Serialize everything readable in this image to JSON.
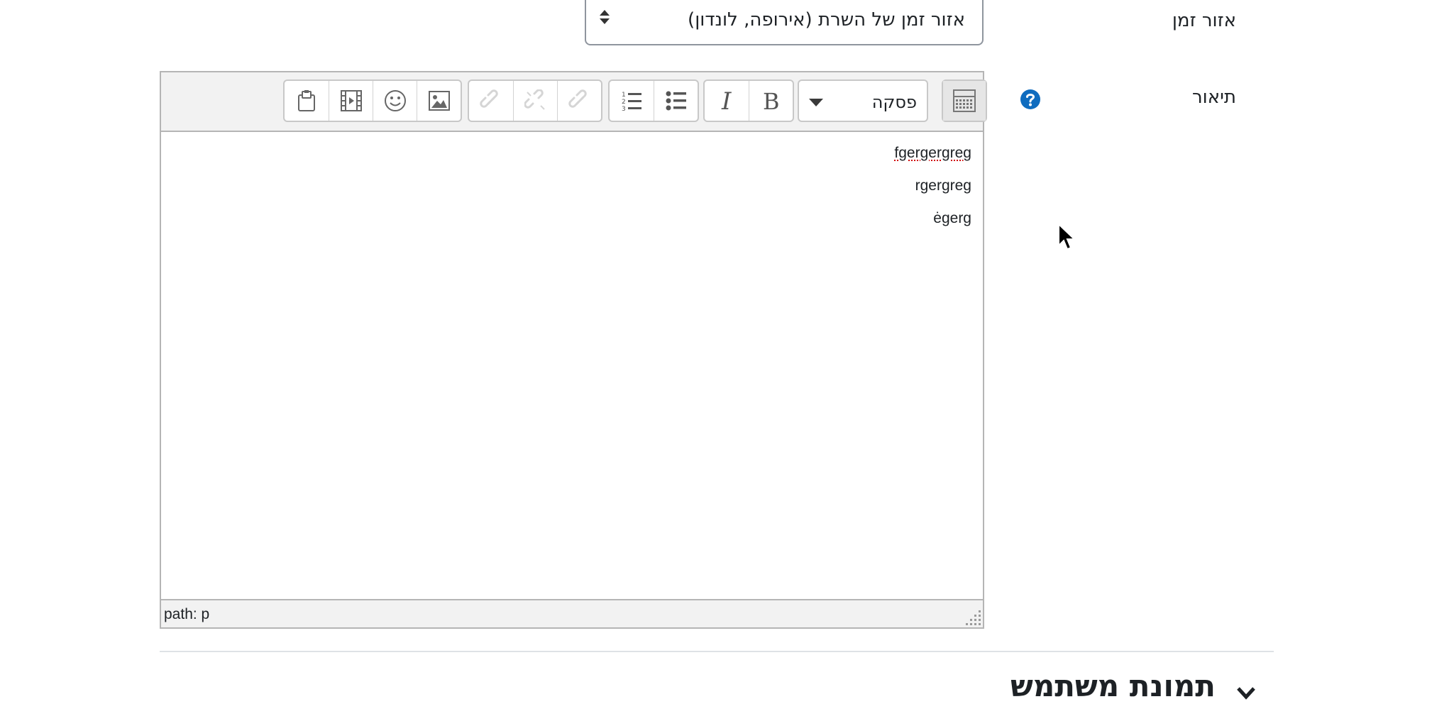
{
  "timezone": {
    "label": "אזור זמן",
    "value": "אזור זמן של השרת (אירופה, לונדון)"
  },
  "description": {
    "label": "תיאור",
    "help_icon": "help-question-icon",
    "editor": {
      "paragraph_style": "פסקה",
      "toolbar_icons": [
        "toggle-toolbar-icon",
        "bold-icon",
        "italic-icon",
        "unordered-list-icon",
        "ordered-list-icon",
        "link-icon",
        "unlink-icon",
        "anchor-icon",
        "image-icon",
        "emoticon-icon",
        "media-icon",
        "manage-files-icon"
      ],
      "lines": [
        "fgergergreg",
        "rgergreg",
        "ėgerg"
      ],
      "status_path": "path: p"
    }
  },
  "user_picture_section": {
    "heading": "תמונת משתמש"
  },
  "colors": {
    "help_icon": "#0f6cbf",
    "toolbar_bg": "#f2f2f2",
    "border": "#b5b5b5"
  }
}
